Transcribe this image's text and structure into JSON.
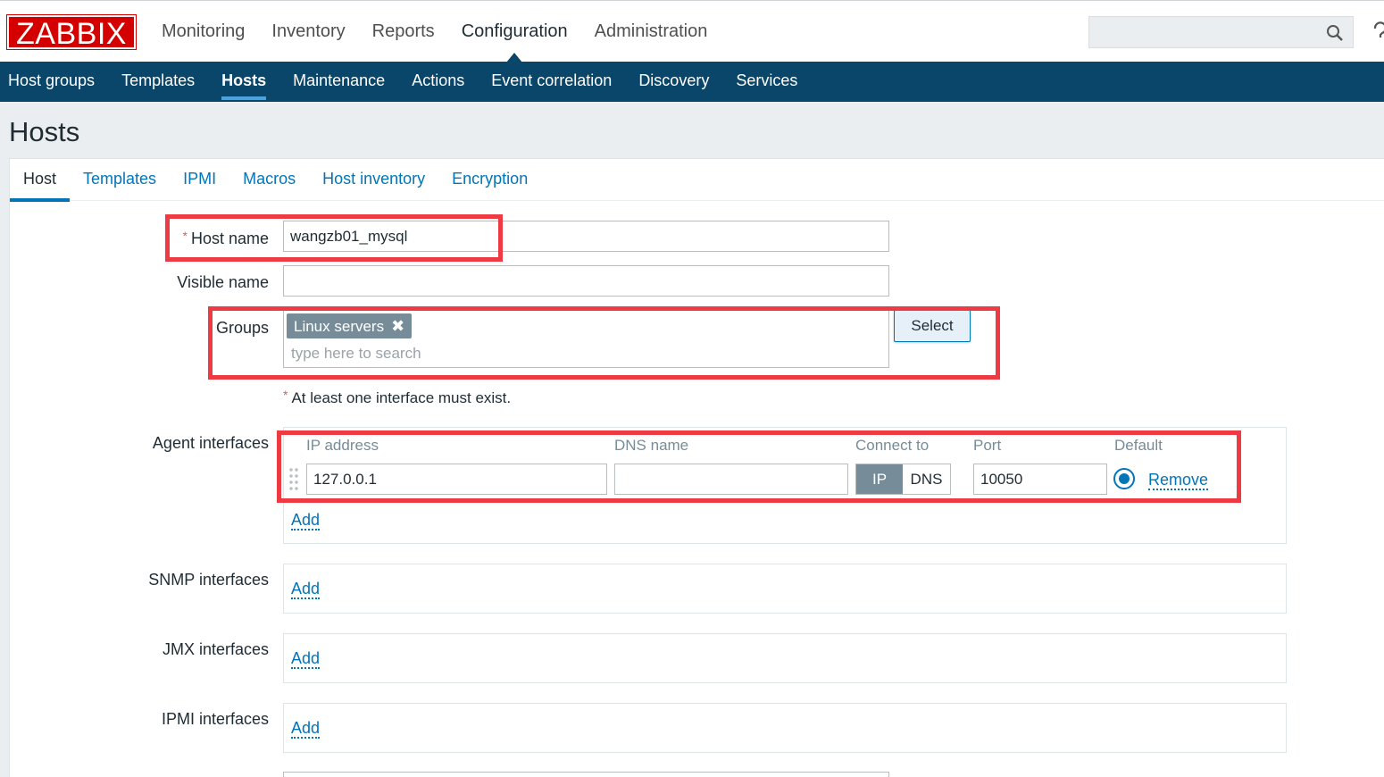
{
  "header": {
    "logo": "ZABBIX",
    "main_menu": [
      "Monitoring",
      "Inventory",
      "Reports",
      "Configuration",
      "Administration"
    ],
    "active_main": "Configuration",
    "search": {
      "value": "",
      "placeholder": ""
    }
  },
  "sub_menu": {
    "items": [
      "Host groups",
      "Templates",
      "Hosts",
      "Maintenance",
      "Actions",
      "Event correlation",
      "Discovery",
      "Services"
    ],
    "active": "Hosts"
  },
  "page": {
    "title": "Hosts"
  },
  "tabs": {
    "items": [
      "Host",
      "Templates",
      "IPMI",
      "Macros",
      "Host inventory",
      "Encryption"
    ],
    "active": "Host"
  },
  "form": {
    "host_name": {
      "label": "Host name",
      "required_mark": "*",
      "value": "wangzb01_mysql"
    },
    "visible_name": {
      "label": "Visible name",
      "value": ""
    },
    "groups": {
      "label": "Groups",
      "required_mark": "*",
      "chips": [
        "Linux servers"
      ],
      "chip_remove": "✖",
      "placeholder": "type here to search",
      "select_label": "Select"
    },
    "interface_hint": {
      "mark": "*",
      "text": "At least one interface must exist."
    },
    "agent_interfaces": {
      "label": "Agent interfaces",
      "columns": {
        "ip": "IP address",
        "dns": "DNS name",
        "connect": "Connect to",
        "port": "Port",
        "default": "Default"
      },
      "row": {
        "ip": "127.0.0.1",
        "dns": "",
        "connect_options": [
          "IP",
          "DNS"
        ],
        "connect_selected": "IP",
        "port": "10050",
        "default_selected": true,
        "remove_label": "Remove"
      },
      "add_label": "Add"
    },
    "snmp_interfaces": {
      "label": "SNMP interfaces",
      "add_label": "Add"
    },
    "jmx_interfaces": {
      "label": "JMX interfaces",
      "add_label": "Add"
    },
    "ipmi_interfaces": {
      "label": "IPMI interfaces",
      "add_label": "Add"
    }
  },
  "colors": {
    "logo_red": "#d40000",
    "submenu_blue": "#0a466a",
    "link_blue": "#0275b8",
    "highlight_red": "#ee3a43",
    "chip_gray": "#768d99"
  }
}
